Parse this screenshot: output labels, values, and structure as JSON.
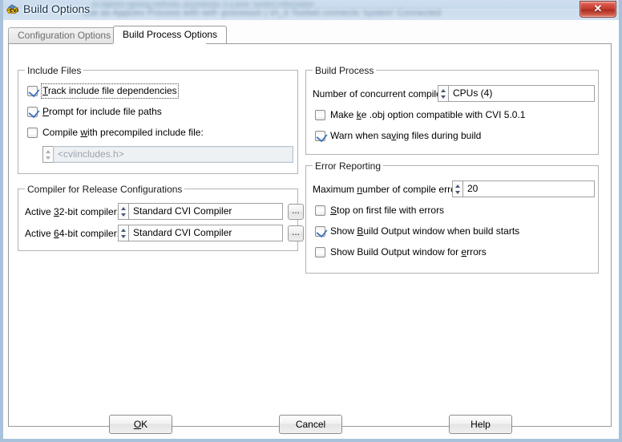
{
  "window": {
    "title": "Build Options",
    "icon": "cvi-app-icon",
    "close_label": "✕",
    "background_blur_line1": "...to highest-naming methods, procedures, it a prior ‘system information",
    "background_blur_line2": "use as AppDev Process with self- processor | VI_3 Toolset connects 'system' Connected"
  },
  "tabs": [
    {
      "label": "Configuration Options",
      "active": false
    },
    {
      "label": "Build Process Options",
      "active": true
    }
  ],
  "groups": {
    "include_files": {
      "title": "Include Files",
      "checkboxes": [
        {
          "label_pre": "",
          "label_u": "T",
          "label_post": "rack include file dependencies",
          "checked": true,
          "focused": true,
          "enabled": true
        },
        {
          "label_pre": "",
          "label_u": "P",
          "label_post": "rompt for include file paths",
          "checked": true,
          "focused": false,
          "enabled": true
        },
        {
          "label_pre": "Compile ",
          "label_u": "w",
          "label_post": "ith precompiled include file:",
          "checked": false,
          "focused": false,
          "enabled": true
        }
      ],
      "include_file_value": "<cviincludes.h>",
      "include_file_enabled": false
    },
    "compiler_release": {
      "title": "Compiler for Release Configurations",
      "rows": [
        {
          "label_pre": "Active ",
          "label_u": "3",
          "label_post": "2-bit compiler:",
          "value": "Standard CVI Compiler",
          "browse": "..."
        },
        {
          "label_pre": "Active ",
          "label_u": "6",
          "label_post": "4-bit compiler:",
          "value": "Standard CVI Compiler",
          "browse": "..."
        }
      ]
    },
    "build_process": {
      "title": "Build Process",
      "concurrent_label": "Number of concurrent compiles",
      "concurrent_value": "CPUs (4)",
      "checkboxes": [
        {
          "label_pre": "Make ",
          "label_u": "k",
          "label_post": "e .obj option compatible with CVI 5.0.1",
          "checked": false,
          "enabled": true
        },
        {
          "label_pre": "Warn when sa",
          "label_u": "v",
          "label_post": "ing files during build",
          "checked": true,
          "enabled": true
        }
      ]
    },
    "error_reporting": {
      "title": "Error Reporting",
      "max_errors_label_pre": "Maximum ",
      "max_errors_label_u": "n",
      "max_errors_label_post": "umber of compile errors:",
      "max_errors_value": "20",
      "checkboxes": [
        {
          "label_pre": "",
          "label_u": "S",
          "label_post": "top on first file with errors",
          "checked": false,
          "enabled": true
        },
        {
          "label_pre": "Show ",
          "label_u": "B",
          "label_post": "uild Output window when build starts",
          "checked": true,
          "enabled": true
        },
        {
          "label_pre": "Show Build Output window for ",
          "label_u": "e",
          "label_post": "rrors",
          "checked": false,
          "enabled": true
        }
      ]
    }
  },
  "buttons": {
    "ok_pre": "",
    "ok_u": "O",
    "ok_post": "K",
    "cancel": "Cancel",
    "help": "Help"
  },
  "colors": {
    "accent_blue": "#2f6cc0",
    "titlebar": "#c6d9ec",
    "close_red": "#c23a2c",
    "frame": "#a9c2dc"
  }
}
